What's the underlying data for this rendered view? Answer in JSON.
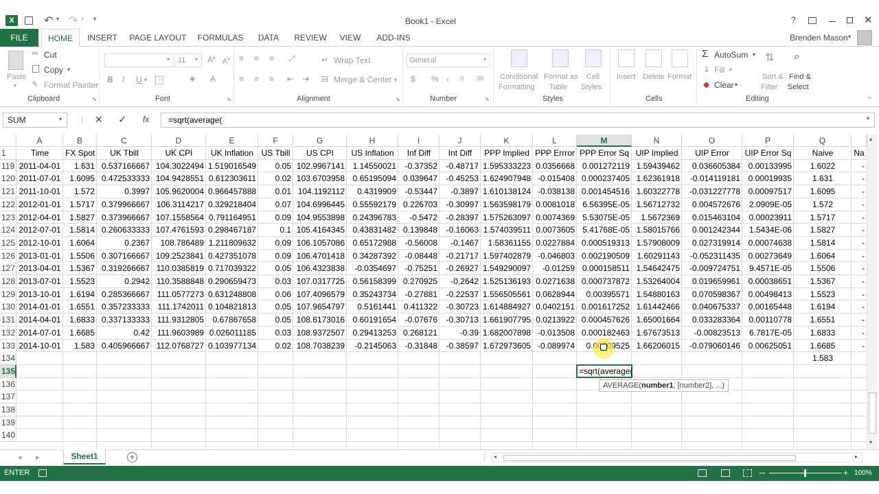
{
  "titlebar": {
    "title": "Book1 - Excel",
    "help": "?",
    "user": "Brenden Mason"
  },
  "tabs": [
    "FILE",
    "HOME",
    "INSERT",
    "PAGE LAYOUT",
    "FORMULAS",
    "DATA",
    "REVIEW",
    "VIEW",
    "ADD-INS"
  ],
  "ribbon": {
    "clipboard": {
      "paste": "Paste",
      "cut": "Cut",
      "copy": "Copy",
      "format_painter": "Format Painter",
      "label": "Clipboard"
    },
    "font": {
      "size": "11",
      "bold": "B",
      "italic": "I",
      "underline": "U",
      "label": "Font"
    },
    "alignment": {
      "wrap": "Wrap Text",
      "merge": "Merge & Center",
      "label": "Alignment"
    },
    "number": {
      "format": "General",
      "dollar": "$",
      "percent": "%",
      "comma": ",",
      "label": "Number"
    },
    "styles": {
      "conditional": "Conditional",
      "conditional2": "Formatting",
      "format_as": "Format as",
      "format_as2": "Table",
      "cell": "Cell",
      "cell2": "Styles",
      "label": "Styles"
    },
    "cells": {
      "insert": "Insert",
      "delete": "Delete",
      "format": "Format",
      "label": "Cells"
    },
    "editing": {
      "autosum": "AutoSum",
      "fill": "Fill",
      "clear": "Clear",
      "sort": "Sort &",
      "sort2": "Filter",
      "find": "Find &",
      "find2": "Select",
      "label": "Editing"
    }
  },
  "formula_bar": {
    "name_box": "SUM",
    "fx": "fx",
    "formula": "=sqrt(average("
  },
  "columns": [
    "A",
    "B",
    "C",
    "D",
    "E",
    "F",
    "G",
    "H",
    "I",
    "J",
    "K",
    "L",
    "M",
    "N",
    "O",
    "P",
    "Q"
  ],
  "headers": [
    "Time",
    "FX Spot",
    "UK Tbill",
    "UK CPI",
    "UK Inflation",
    "US Tbill",
    "US CPI",
    "US Inflation",
    "Inf Diff",
    "Int Diff",
    "PPP Implied",
    "PPP Errror",
    "PPP Error Sq",
    "UIP Implied",
    "UIP Error",
    "UIP Error Sq",
    "Naive",
    "Na"
  ],
  "rows": [
    [
      "119",
      "2011-04-01",
      "1.631",
      "0.537166667",
      "104.3022494",
      "1.519016549",
      "0.05",
      "102.9967141",
      "1.14550021",
      "-0.37352",
      "-0.48717",
      "1.595333223",
      "0.0356668",
      "0.001272119",
      "1.59439462",
      "0.036605384",
      "0.00133995",
      "1.6022"
    ],
    [
      "120",
      "2011-07-01",
      "1.6095",
      "0.472533333",
      "104.9428551",
      "0.612303611",
      "0.02",
      "103.6703958",
      "0.65195094",
      "0.039647",
      "-0.45253",
      "1.624907948",
      "-0.015408",
      "0.000237405",
      "1.62361918",
      "-0.014119181",
      "0.00019935",
      "1.631"
    ],
    [
      "121",
      "2011-10-01",
      "1.572",
      "0.3997",
      "105.9620004",
      "0.966457888",
      "0.01",
      "104.1192112",
      "0.4319909",
      "-0.53447",
      "-0.3897",
      "1.610138124",
      "-0.038138",
      "0.001454516",
      "1.60322778",
      "-0.031227778",
      "0.00097517",
      "1.6095"
    ],
    [
      "122",
      "2012-01-01",
      "1.5717",
      "0.379966667",
      "106.3114217",
      "0.329218404",
      "0.07",
      "104.6996445",
      "0.55592179",
      "0.226703",
      "-0.30997",
      "1.563598179",
      "0.0081018",
      "6.56395E-05",
      "1.56712732",
      "0.004572676",
      "2.0909E-05",
      "1.572"
    ],
    [
      "123",
      "2012-04-01",
      "1.5827",
      "0.373966667",
      "107.1558564",
      "0.791164951",
      "0.09",
      "104.9553898",
      "0.24396783",
      "-0.5472",
      "-0.28397",
      "1.575263097",
      "0.0074369",
      "5.53075E-05",
      "1.5672369",
      "0.015463104",
      "0.00023911",
      "1.5717"
    ],
    [
      "124",
      "2012-07-01",
      "1.5814",
      "0.260633333",
      "107.4761593",
      "0.298467187",
      "0.1",
      "105.4164345",
      "0.43831482",
      "0.139848",
      "-0.16063",
      "1.574039511",
      "0.0073605",
      "5.41768E-05",
      "1.58015766",
      "0.001242344",
      "1.5434E-06",
      "1.5827"
    ],
    [
      "125",
      "2012-10-01",
      "1.6064",
      "0.2367",
      "108.786489",
      "1.211809632",
      "0.09",
      "106.1057086",
      "0.65172988",
      "-0.56008",
      "-0.1467",
      "1.58361155",
      "0.0227884",
      "0.000519313",
      "1.57908009",
      "0.027319914",
      "0.00074638",
      "1.5814"
    ],
    [
      "126",
      "2013-01-01",
      "1.5506",
      "0.307166667",
      "109.2523841",
      "0.427351078",
      "0.09",
      "106.4701418",
      "0.34287392",
      "-0.08448",
      "-0.21717",
      "1.597402879",
      "-0.046803",
      "0.002190509",
      "1.60291143",
      "-0.052311435",
      "0.00273649",
      "1.6064"
    ],
    [
      "127",
      "2013-04-01",
      "1.5367",
      "0.319266667",
      "110.0385819",
      "0.717039322",
      "0.05",
      "106.4323838",
      "-0.0354697",
      "-0.75251",
      "-0.26927",
      "1.549290097",
      "-0.01259",
      "0.000158511",
      "1.54642475",
      "-0.009724751",
      "9.4571E-05",
      "1.5506"
    ],
    [
      "128",
      "2013-07-01",
      "1.5523",
      "0.2942",
      "110.3588848",
      "0.290659473",
      "0.03",
      "107.0317725",
      "0.56158399",
      "0.270925",
      "-0.2642",
      "1.525136193",
      "0.0271638",
      "0.000737872",
      "1.53264004",
      "0.019659961",
      "0.00038651",
      "1.5367"
    ],
    [
      "129",
      "2013-10-01",
      "1.6194",
      "0.285366667",
      "111.0577273",
      "0.631248808",
      "0.06",
      "107.4096579",
      "0.35243734",
      "-0.27881",
      "-0.22537",
      "1.556505561",
      "0.0628944",
      "0.00395571",
      "1.54880163",
      "0.070598367",
      "0.00498413",
      "1.5523"
    ],
    [
      "130",
      "2014-01-01",
      "1.6551",
      "0.357233333",
      "111.1742011",
      "0.104821813",
      "0.05",
      "107.9654797",
      "0.5161441",
      "0.411322",
      "-0.30723",
      "1.614884927",
      "0.0402151",
      "0.001617252",
      "1.61442466",
      "0.040675337",
      "0.00165448",
      "1.6194"
    ],
    [
      "131",
      "2014-04-01",
      "1.6833",
      "0.337133333",
      "111.9312805",
      "0.67867658",
      "0.05",
      "108.6173016",
      "0.60191654",
      "-0.07676",
      "-0.30713",
      "1.661907795",
      "0.0213922",
      "0.000457626",
      "1.65001664",
      "0.033283364",
      "0.00110778",
      "1.6551"
    ],
    [
      "132",
      "2014-07-01",
      "1.6685",
      "0.42",
      "111.9603989",
      "0.026011185",
      "0.03",
      "108.9372507",
      "0.29413253",
      "0.268121",
      "-0.39",
      "1.682007898",
      "-0.013508",
      "0.000182463",
      "1.67673513",
      "-0.00823513",
      "6.7817E-05",
      "1.6833"
    ],
    [
      "133",
      "2014-10-01",
      "1.583",
      "0.405966667",
      "112.0768727",
      "0.103977134",
      "0.02",
      "108.7038239",
      "-0.2145063",
      "-0.31848",
      "-0.38597",
      "1.672973605",
      "-0.089974",
      "0.00809525",
      "1.66206015",
      "-0.079060146",
      "0.00625051",
      "1.6685"
    ]
  ],
  "row134": {
    "num": "134",
    "naive": "1.583"
  },
  "empty_rows": [
    "135",
    "136",
    "137",
    "138",
    "139",
    "140"
  ],
  "editing_cell": "=sqrt(average(",
  "tooltip": {
    "fn": "AVERAGE(",
    "arg1": "number1",
    ",rest": ", [number2], ...)"
  },
  "sheet_tab": "Sheet1",
  "status": {
    "mode": "ENTER",
    "zoom": "100%"
  }
}
